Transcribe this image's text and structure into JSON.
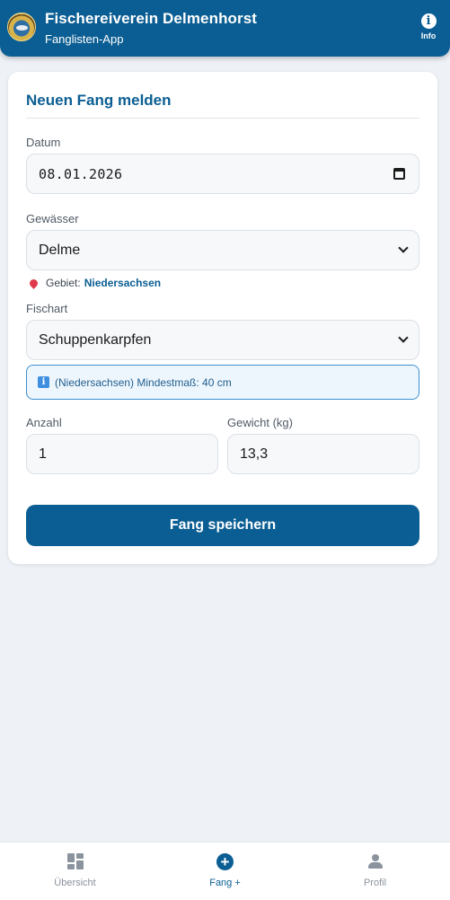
{
  "header": {
    "title": "Fischereiverein Delmenhorst",
    "subtitle": "Fanglisten-App",
    "info_label": "Info"
  },
  "form": {
    "title": "Neuen Fang melden",
    "date": {
      "label": "Datum",
      "value": "08.01.2026"
    },
    "water": {
      "label": "Gewässer",
      "value": "Delme"
    },
    "region": {
      "prefix": "Gebiet:",
      "value": "Niedersachsen"
    },
    "fish": {
      "label": "Fischart",
      "value": "Schuppenkarpfen"
    },
    "notice": "(Niedersachsen) Mindestmaß: 40 cm",
    "count": {
      "label": "Anzahl",
      "value": "1"
    },
    "weight": {
      "label": "Gewicht (kg)",
      "value": "13,3"
    },
    "submit_label": "Fang speichern"
  },
  "nav": {
    "items": [
      {
        "label": "Übersicht",
        "icon": "dashboard-icon",
        "active": false
      },
      {
        "label": "Fang +",
        "icon": "plus-circle-icon",
        "active": true
      },
      {
        "label": "Profil",
        "icon": "user-icon",
        "active": false
      }
    ]
  },
  "colors": {
    "primary": "#0b5e93",
    "background": "#eef2f7",
    "notice_border": "#3b8fd0"
  }
}
